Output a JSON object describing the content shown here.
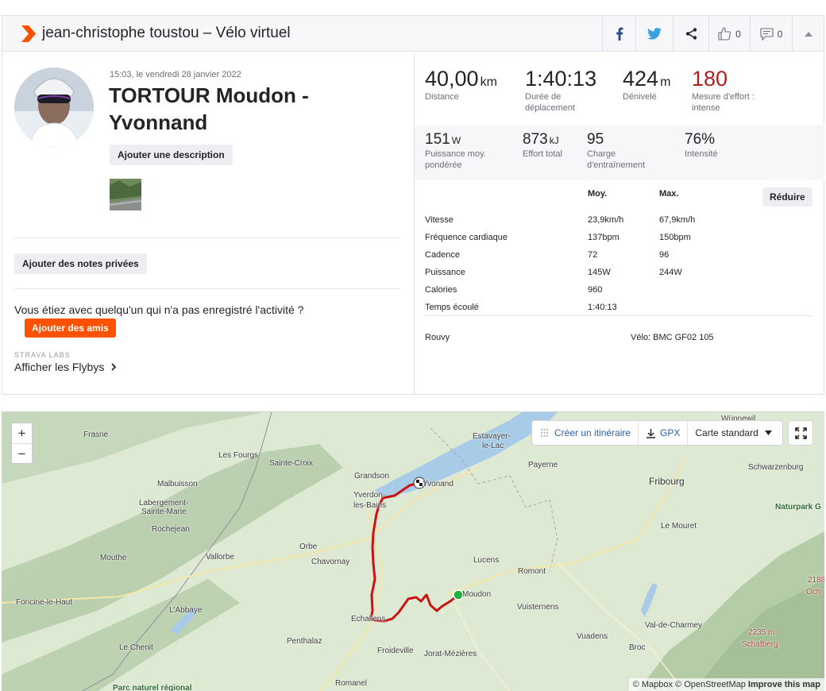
{
  "header": {
    "title": "jean-christophe toustou – Vélo virtuel",
    "kudos_count": "0",
    "comment_count": "0"
  },
  "activity": {
    "date": "15:03, le vendredi 28 janvier 2022",
    "title": "TORTOUR Moudon - Yvonnand",
    "add_description": "Ajouter une description",
    "add_private_notes": "Ajouter des notes privées",
    "with_others_text": "Vous étiez avec quelqu'un qui n'a pas enregistré l'activité ?",
    "add_friends": "Ajouter des amis",
    "labs_tag": "STRAVA LABS",
    "flybys": "Afficher les Flybys"
  },
  "stats_primary": [
    {
      "value": "40,00",
      "unit": "km",
      "label": "Distance"
    },
    {
      "value": "1:40:13",
      "unit": "",
      "label": "Durée de déplacement"
    },
    {
      "value": "424",
      "unit": "m",
      "label": "Dénivelé"
    },
    {
      "value": "180",
      "unit": "",
      "label": "Mesure d'effort : intense"
    }
  ],
  "stats_secondary": [
    {
      "value": "151",
      "unit": "W",
      "label": "Puissance moy. pondérée"
    },
    {
      "value": "873",
      "unit": "kJ",
      "label": "Effort total"
    },
    {
      "value": "95",
      "unit": "",
      "label": "Charge d'entraînement"
    },
    {
      "value": "76%",
      "unit": "",
      "label": "Intensité"
    }
  ],
  "table": {
    "col_avg": "Moy.",
    "col_max": "Max.",
    "reduce": "Réduire",
    "rows": [
      {
        "label": "Vitesse",
        "avg": "23,9km/h",
        "max": "67,9km/h"
      },
      {
        "label": "Fréquence cardiaque",
        "avg": "137bpm",
        "max": "150bpm"
      },
      {
        "label": "Cadence",
        "avg": "72",
        "max": "96"
      },
      {
        "label": "Puissance",
        "avg": "145W",
        "max": "244W"
      },
      {
        "label": "Calories",
        "avg": "960",
        "max": ""
      },
      {
        "label": "Temps écoulé",
        "avg": "1:40:13",
        "max": ""
      }
    ]
  },
  "device": "Rouvy",
  "bike": "Vélo: BMC GF02 105",
  "map": {
    "create_route": "Créer un itinéraire",
    "gpx": "GPX",
    "style": "Carte standard",
    "attribution_mapbox": "© Mapbox",
    "attribution_osm": "© OpenStreetMap",
    "improve": "Improve this map",
    "places": [
      {
        "name": "Frasne"
      },
      {
        "name": "Les Fourgs"
      },
      {
        "name": "Sainte-Croix"
      },
      {
        "name": "Grandson"
      },
      {
        "name": "Yvonand"
      },
      {
        "name": "Yverdon-"
      },
      {
        "name": "les-Bains"
      },
      {
        "name": "Estavayer-"
      },
      {
        "name": "le-Lac"
      },
      {
        "name": "Payerne"
      },
      {
        "name": "Fribourg"
      },
      {
        "name": "Schwarzenburg"
      },
      {
        "name": "Wünnewil"
      },
      {
        "name": "Naturpark G"
      },
      {
        "name": "Malbuisson"
      },
      {
        "name": "Labergement-"
      },
      {
        "name": "Sainte-Marie"
      },
      {
        "name": "Rochejean"
      },
      {
        "name": "Mouthe"
      },
      {
        "name": "Vallorbe"
      },
      {
        "name": "Orbe"
      },
      {
        "name": "Chavornay"
      },
      {
        "name": "Le Mouret"
      },
      {
        "name": "Lucens"
      },
      {
        "name": "Romont"
      },
      {
        "name": "Moudon"
      },
      {
        "name": "Foncine-le-Haut"
      },
      {
        "name": "L'Abbaye"
      },
      {
        "name": "Echallens"
      },
      {
        "name": "Vuisternens"
      },
      {
        "name": "Val-de-Charmey"
      },
      {
        "name": "2188"
      },
      {
        "name": "Och"
      },
      {
        "name": "Penthalaz"
      },
      {
        "name": "Vuadens"
      },
      {
        "name": "2235 m"
      },
      {
        "name": "Schafberg"
      },
      {
        "name": "Le Chenit"
      },
      {
        "name": "Froideville"
      },
      {
        "name": "Jorat-Mézières"
      },
      {
        "name": "Broc"
      },
      {
        "name": "Parc naturel régional"
      },
      {
        "name": "Romanel"
      }
    ]
  },
  "colors": {
    "brand_orange": "#fc5200",
    "effort_red": "#b01f1f",
    "route_red": "#cc1111",
    "link_blue": "#2b62a8",
    "start_green": "#22b03a"
  }
}
